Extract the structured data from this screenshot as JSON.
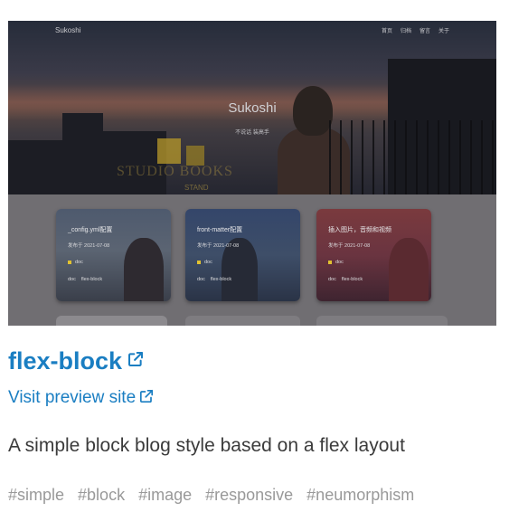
{
  "preview": {
    "logo": "Sukoshi",
    "nav": [
      "首页",
      "归档",
      "留言",
      "关于"
    ],
    "site_title": "Sukoshi",
    "site_subtitle": "不说话 装高手",
    "deco_text": "STUDIO BOOKS",
    "deco_text_small": "STAND",
    "cards": [
      {
        "title": "_config.yml配置",
        "meta": "发布于 2021-07-08",
        "category": "doc",
        "tags": [
          "doc",
          "flex-block"
        ]
      },
      {
        "title": "front-matter配置",
        "meta": "发布于 2021-07-08",
        "category": "doc",
        "tags": [
          "doc",
          "flex-block"
        ]
      },
      {
        "title": "插入图片，音频和视频",
        "meta": "发布于 2021-07-08",
        "category": "doc",
        "tags": [
          "doc",
          "flex-block"
        ]
      }
    ]
  },
  "project": {
    "title": "flex-block",
    "preview_link": "Visit preview site",
    "description": "A simple block blog style based on a flex layout",
    "tags": [
      "#simple",
      "#block",
      "#image",
      "#responsive",
      "#neumorphism"
    ]
  },
  "colors": {
    "link": "#1a7ec2",
    "text": "#3b3b3b",
    "tag": "#999999",
    "category_square": "#e2c230"
  },
  "icons": {
    "title_link": "external-link-icon",
    "preview_link": "external-link-icon"
  }
}
